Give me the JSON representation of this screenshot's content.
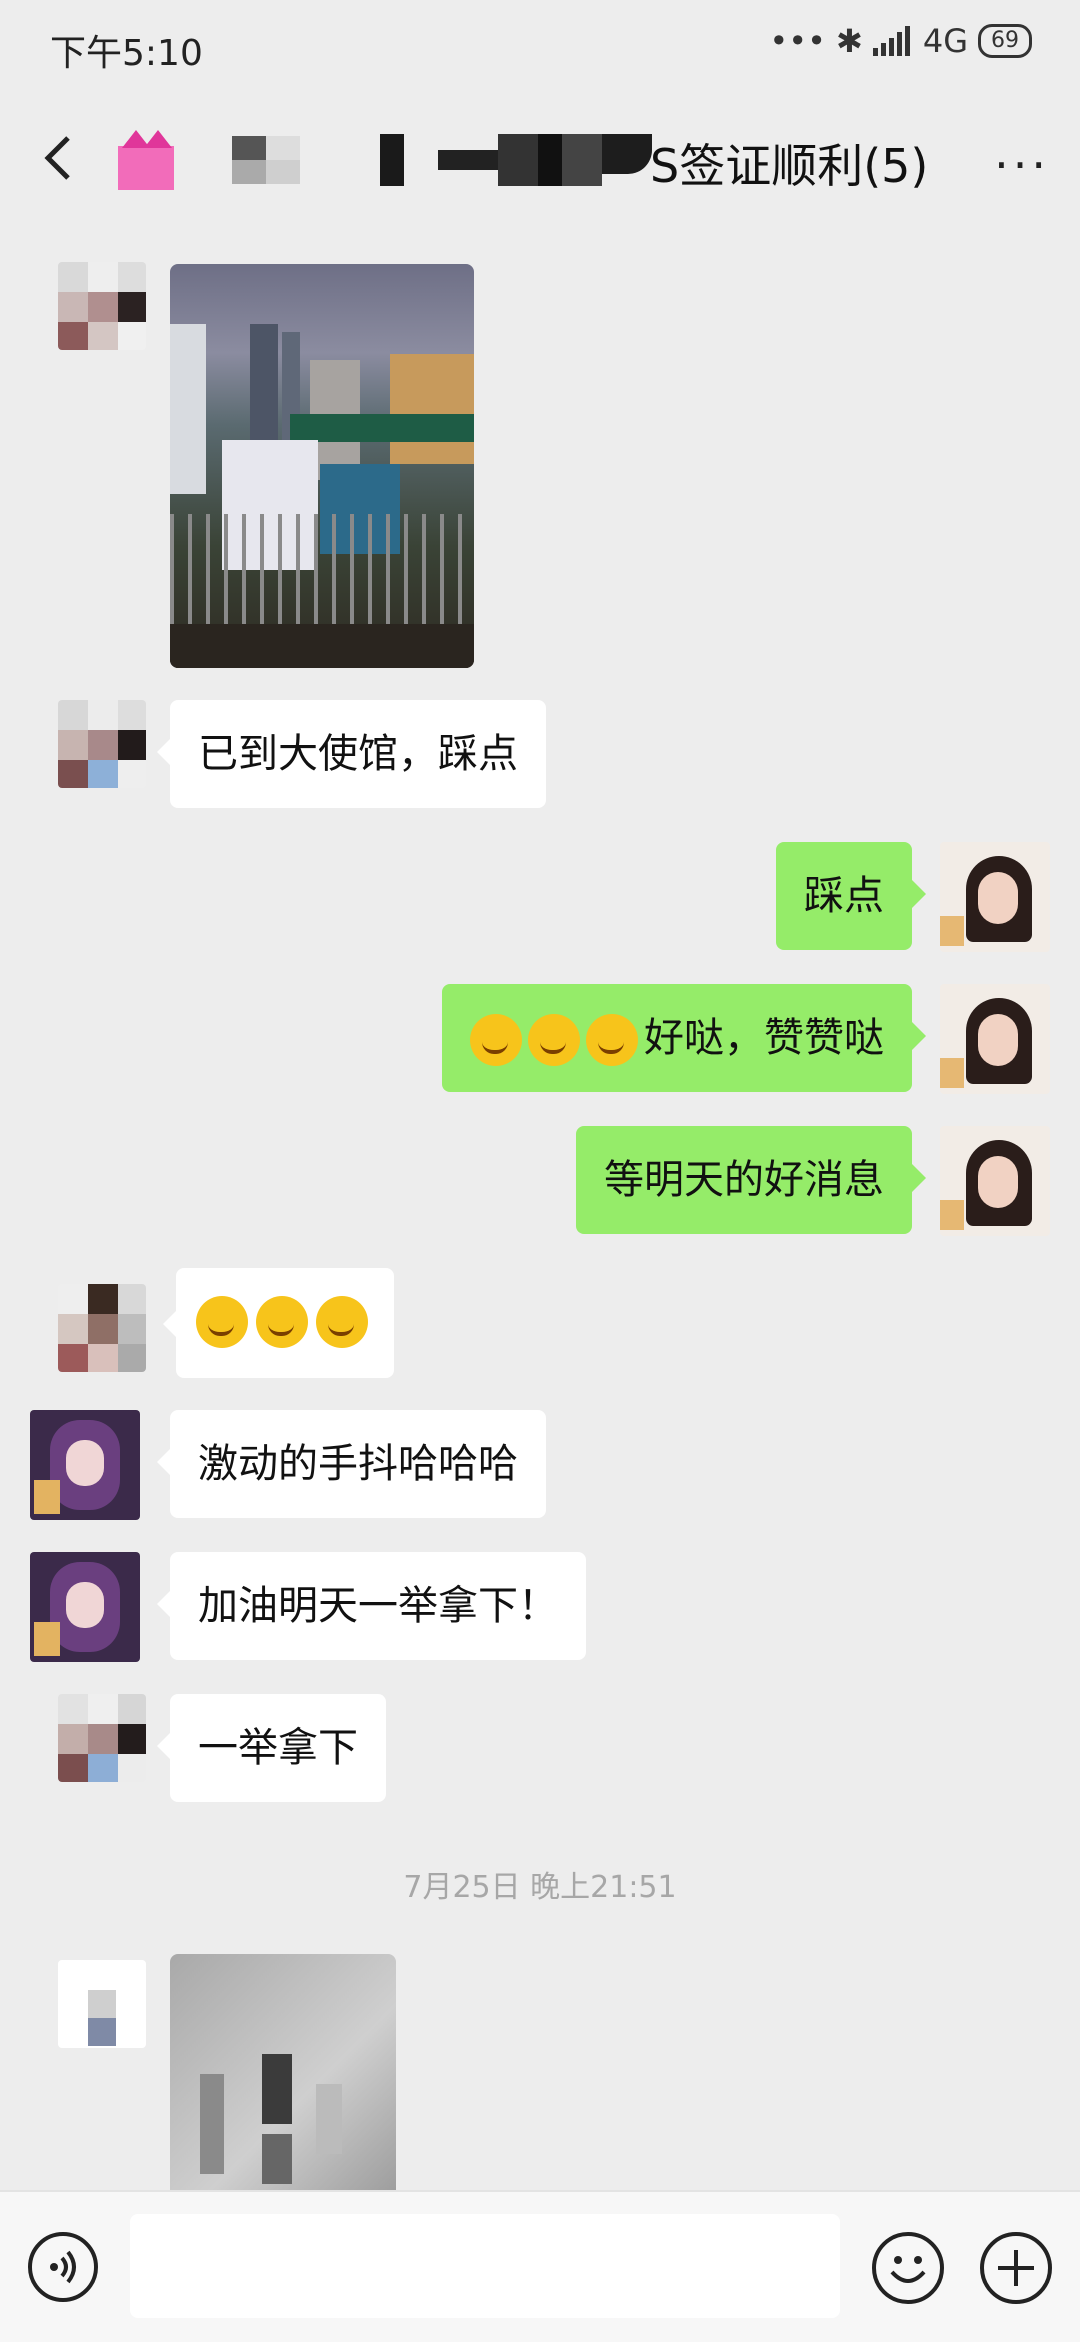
{
  "status_bar": {
    "time": "下午5:10",
    "dots": "•••",
    "bluetooth": "✱",
    "signal": "4G",
    "battery": "69"
  },
  "header": {
    "title": "S签证顺利(5)",
    "more": "···"
  },
  "messages": {
    "m2": "已到大使馆，踩点",
    "m3": "踩点",
    "m4": "好哒，赞赞哒",
    "m5": "等明天的好消息",
    "m7": "激动的手抖哈哈哈",
    "m8": "加油明天一举拿下！",
    "m9": "一举拿下"
  },
  "timestamp": "7月25日 晚上21:51",
  "icons": {
    "back": "chevron-left-icon",
    "voice": "voice-icon",
    "emoji": "smiley-icon",
    "plus": "plus-icon"
  },
  "colors": {
    "background": "#ededed",
    "outgoing_bubble": "#95ec69",
    "incoming_bubble": "#ffffff"
  }
}
